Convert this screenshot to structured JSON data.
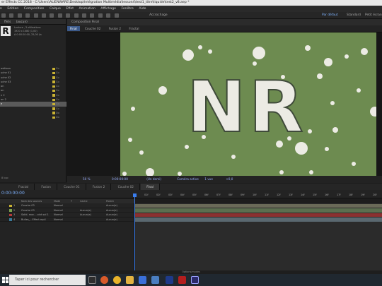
{
  "titlebar": {
    "title": "er Effects CC 2018 - C:\\Users\\ALIENWARE\\Desktop\\Intégration Multimédia\\lesson4\\test1_titre\\liquide\\test2_v8.aep *"
  },
  "menu": [
    "n",
    "Edition",
    "Composition",
    "Calque",
    "Effet",
    "Animation",
    "Affichage",
    "Fenêtre",
    "Aide"
  ],
  "toolbar": {
    "snap_label": "Accrochage",
    "workspace": "Par défaut",
    "standard": "Standard",
    "small_screen": "Petit écran"
  },
  "project": {
    "tabs": [
      "ffets",
      "(aucun)"
    ],
    "thumb_letter": "R",
    "info": [
      "Lecture , 3 utilisations",
      "1920 x 1080 (1,00)",
      "Δ 0:00:20:00, 25,00 i/s"
    ],
    "items": [
      {
        "name": "ositions",
        "type": "Co"
      },
      {
        "name": "uche 01",
        "type": "Co"
      },
      {
        "name": "uche 02",
        "type": "Co"
      },
      {
        "name": "uche 03",
        "type": "Co"
      },
      {
        "name": "on",
        "type": "Co"
      },
      {
        "name": "on",
        "type": "Co"
      },
      {
        "name": "n 2",
        "type": "Co"
      },
      {
        "name": "on 2",
        "type": "Co"
      },
      {
        "name": "e",
        "type": "Co"
      },
      {
        "name": "",
        "type": "Co"
      },
      {
        "name": "",
        "type": "Do"
      },
      {
        "name": "",
        "type": "Do"
      }
    ],
    "bottom_bits": "8 bpc"
  },
  "comp_panel": {
    "header": "Composition Final",
    "crumbs": [
      "Final",
      "Couche 02",
      "Fusion 2",
      "Fractal"
    ],
    "text": "NR",
    "bottom": [
      "50 %",
      "0:00:00:00",
      "(Un demi)",
      "Caméra active",
      "1 vue",
      "+0,0"
    ]
  },
  "timeline": {
    "tabs": [
      "Fractal",
      "Fusion",
      "Couche 01",
      "Fusion 2",
      "Couche 02",
      "Final"
    ],
    "active_tab": "Final",
    "timecode": "0:00:00:00",
    "ruler": [
      "01f",
      "02f",
      "03f",
      "04f",
      "05f",
      "06f",
      "07f",
      "08f",
      "09f",
      "10f",
      "11f",
      "12f",
      "13f",
      "14f",
      "15f",
      "16f",
      "17f",
      "18f",
      "19f",
      "20f"
    ],
    "columns": {
      "name": "Nom des sources",
      "mode": "Mode",
      "track": "T",
      "cache": "Cache",
      "parent": "Parent"
    },
    "layers": [
      {
        "num": "1",
        "name": "Couche 03",
        "mode": "Normal",
        "cache": "",
        "parent": "Aucun(e)",
        "color": "#c9b233",
        "bar": "#6a6a58"
      },
      {
        "num": "2",
        "name": "Couche 03",
        "mode": "Normal",
        "cache": "Aucun(e)",
        "parent": "Aucun(e)",
        "color": "#7aa04e",
        "bar": "#5b6e4f"
      },
      {
        "num": "3",
        "name": "Solid. moc... oint sol 1",
        "mode": "Normal",
        "cache": "Aucun(e)",
        "parent": "Aucun(e)",
        "color": "#b33a3a",
        "bar": "#8a3030"
      },
      {
        "num": "4",
        "name": "Bulles_...Effect.mp4",
        "mode": "Normal",
        "cache": "",
        "parent": "Aucun(e)",
        "color": "#3a7a9a",
        "bar": "#5a6870"
      }
    ],
    "status": "Options/modes"
  },
  "taskbar": {
    "search_placeholder": "Taper ici pour rechercher"
  },
  "colors": {
    "canvas_bg": "#6d8b50",
    "accent": "#3a7ef0"
  }
}
